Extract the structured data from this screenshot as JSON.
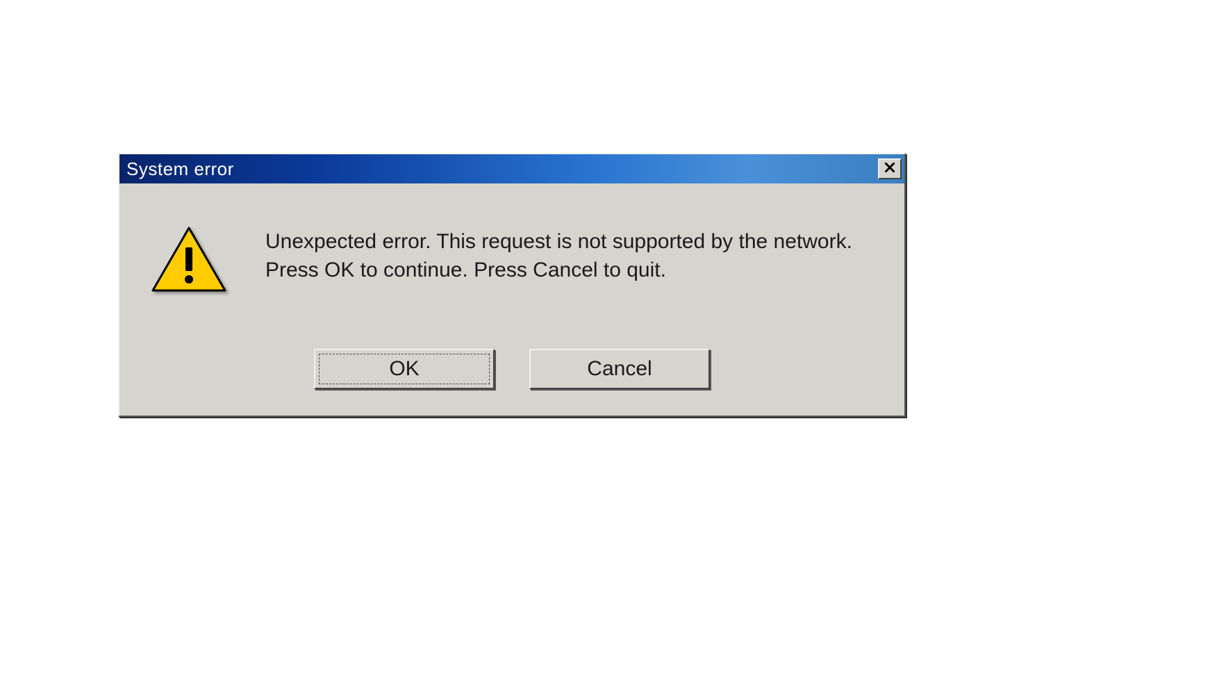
{
  "dialog": {
    "title": "System error",
    "message": "Unexpected error. This request is not supported by the network.\nPress OK to continue. Press Cancel to quit.",
    "buttons": {
      "ok": "OK",
      "cancel": "Cancel"
    }
  }
}
